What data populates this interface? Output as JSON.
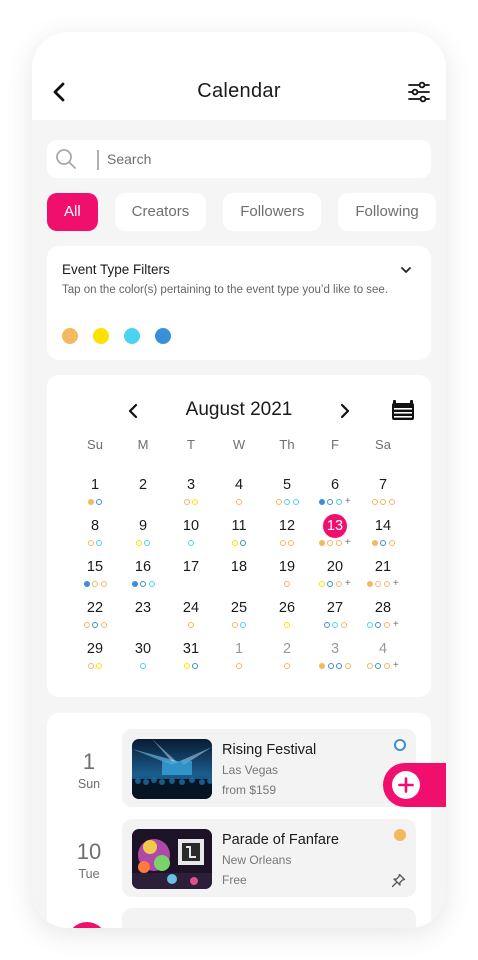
{
  "header": {
    "title": "Calendar"
  },
  "search": {
    "placeholder": "Search"
  },
  "chips": [
    {
      "label": "All",
      "active": true
    },
    {
      "label": "Creators",
      "active": false
    },
    {
      "label": "Followers",
      "active": false
    },
    {
      "label": "Following",
      "active": false
    }
  ],
  "filters": {
    "title": "Event Type Filters",
    "description": "Tap on the color(s) pertaining to the event type you’d like to see.",
    "colors": [
      "#f4b860",
      "#ffe100",
      "#4ad4f2",
      "#3a8fd8"
    ]
  },
  "calendar": {
    "month": "August 2021",
    "weekdays": [
      "Su",
      "M",
      "T",
      "W",
      "Th",
      "F",
      "Sa"
    ],
    "weeks": [
      [
        {
          "d": "1",
          "dots": [
            "o-filled",
            "b-ring"
          ]
        },
        {
          "d": "2",
          "dots": []
        },
        {
          "d": "3",
          "dots": [
            "o-ring",
            "y-ring"
          ]
        },
        {
          "d": "4",
          "dots": [
            "o-ring"
          ]
        },
        {
          "d": "5",
          "dots": [
            "o-ring",
            "c-ring",
            "c-ring"
          ]
        },
        {
          "d": "6",
          "dots": [
            "b-filled",
            "b-ring",
            "c-ring",
            "plus"
          ]
        },
        {
          "d": "7",
          "dots": [
            "o-ring",
            "o-ring",
            "o-ring"
          ]
        }
      ],
      [
        {
          "d": "8",
          "dots": [
            "o-ring",
            "c-ring"
          ]
        },
        {
          "d": "9",
          "dots": [
            "y-ring",
            "c-ring"
          ]
        },
        {
          "d": "10",
          "dots": [
            "c-ring"
          ]
        },
        {
          "d": "11",
          "dots": [
            "y-ring",
            "b-ring"
          ]
        },
        {
          "d": "12",
          "dots": [
            "o-ring",
            "o-ring"
          ]
        },
        {
          "d": "13",
          "dots": [
            "o-filled",
            "o-ring",
            "o-ring",
            "plus"
          ],
          "today": true
        },
        {
          "d": "14",
          "dots": [
            "o-filled",
            "b-ring",
            "o-ring"
          ]
        }
      ],
      [
        {
          "d": "15",
          "dots": [
            "b-filled",
            "o-ring",
            "o-ring"
          ]
        },
        {
          "d": "16",
          "dots": [
            "b-filled",
            "b-ring",
            "c-ring"
          ]
        },
        {
          "d": "17",
          "dots": []
        },
        {
          "d": "18",
          "dots": []
        },
        {
          "d": "19",
          "dots": [
            "o-ring"
          ]
        },
        {
          "d": "20",
          "dots": [
            "y-ring",
            "b-ring",
            "o-ring",
            "plus"
          ]
        },
        {
          "d": "21",
          "dots": [
            "o-filled",
            "o-ring",
            "o-ring",
            "plus"
          ]
        }
      ],
      [
        {
          "d": "22",
          "dots": [
            "o-ring",
            "b-ring",
            "o-ring"
          ]
        },
        {
          "d": "23",
          "dots": []
        },
        {
          "d": "24",
          "dots": [
            "o-ring"
          ]
        },
        {
          "d": "25",
          "dots": [
            "o-ring",
            "c-ring"
          ]
        },
        {
          "d": "26",
          "dots": [
            "y-ring"
          ]
        },
        {
          "d": "27",
          "dots": [
            "b-ring",
            "c-ring",
            "o-ring"
          ]
        },
        {
          "d": "28",
          "dots": [
            "c-ring",
            "b-ring",
            "o-ring",
            "plus"
          ]
        }
      ],
      [
        {
          "d": "29",
          "dots": [
            "o-ring",
            "y-ring"
          ]
        },
        {
          "d": "30",
          "dots": [
            "c-ring"
          ]
        },
        {
          "d": "31",
          "dots": [
            "y-ring",
            "b-ring"
          ]
        },
        {
          "d": "1",
          "dots": [
            "o-ring"
          ],
          "muted": true
        },
        {
          "d": "2",
          "dots": [
            "o-ring"
          ],
          "muted": true
        },
        {
          "d": "3",
          "dots": [
            "o-filled",
            "b-ring",
            "b-ring",
            "o-ring"
          ],
          "muted": true
        },
        {
          "d": "4",
          "dots": [
            "o-ring",
            "b-ring",
            "o-ring",
            "plus"
          ],
          "muted": true
        }
      ]
    ]
  },
  "events": [
    {
      "day": "1",
      "weekday": "Sun",
      "title": "Rising Festival",
      "location": "Las Vegas",
      "price": "from $159",
      "marker": "ring"
    },
    {
      "day": "10",
      "weekday": "Tue",
      "title": "Parade of Fanfare",
      "location": "New Orleans",
      "price": "Free",
      "marker": "filled"
    }
  ],
  "palette": {
    "accent": "#f10f6d",
    "orange": "#f4b860",
    "yellow": "#ffe100",
    "cyan": "#4ad4f2",
    "blue": "#3a8fd8"
  },
  "icons": {
    "back": "chevron-left-icon",
    "filter": "sliders-icon",
    "search": "search-icon",
    "expand": "chevron-down-icon",
    "calendar_view": "calendar-view-icon",
    "pin": "pin-icon",
    "add": "plus-icon"
  }
}
